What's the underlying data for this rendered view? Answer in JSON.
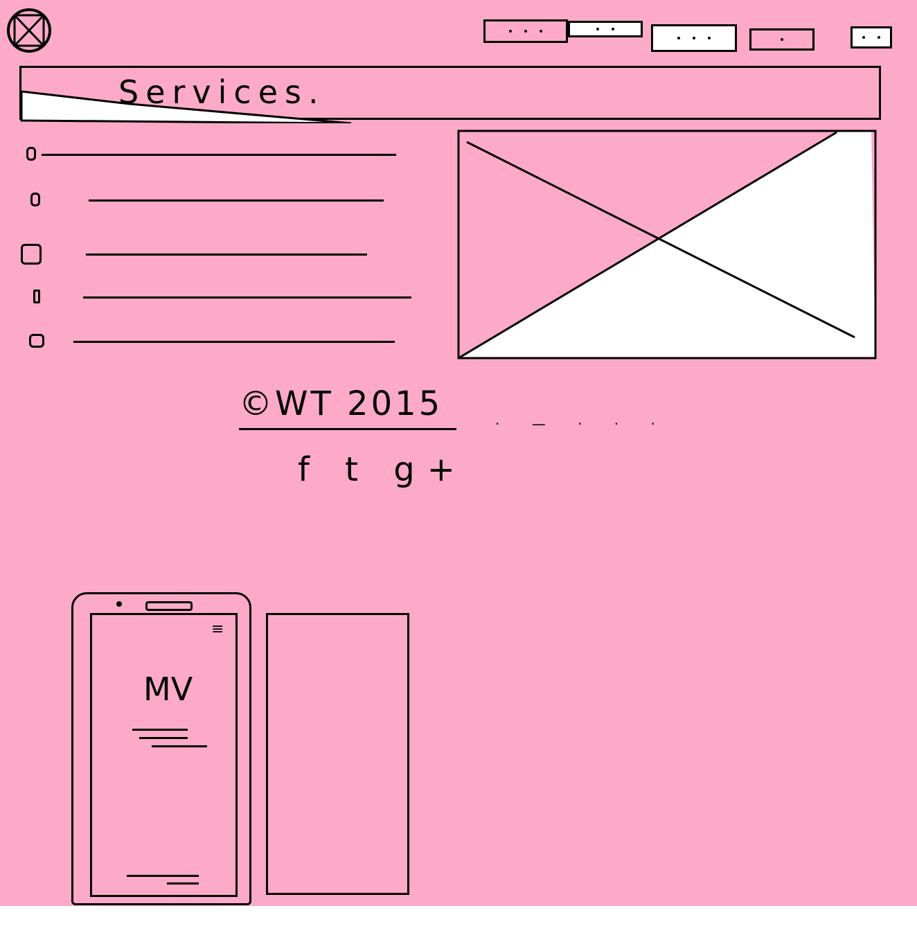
{
  "header": {
    "logo": "logo-placeholder",
    "nav_items": [
      {
        "label": "..."
      },
      {
        "label": "..."
      },
      {
        "label": "..."
      },
      {
        "label": "."
      },
      {
        "label": ".."
      }
    ]
  },
  "banner": {
    "title": "Services."
  },
  "services": {
    "items": [
      {
        "icon": "bullet"
      },
      {
        "icon": "bullet"
      },
      {
        "icon": "bullet"
      },
      {
        "icon": "bullet"
      },
      {
        "icon": "bullet"
      }
    ]
  },
  "image_placeholder": {
    "icon": "image-placeholder"
  },
  "footer": {
    "copyright": "©WT 2015",
    "trailing": "· — · · ·",
    "social": [
      "f",
      "t",
      "g+"
    ]
  },
  "mobile_mockup": {
    "logo_text": "MV"
  },
  "colors": {
    "background": "#fcaac8",
    "ink": "#000000"
  }
}
